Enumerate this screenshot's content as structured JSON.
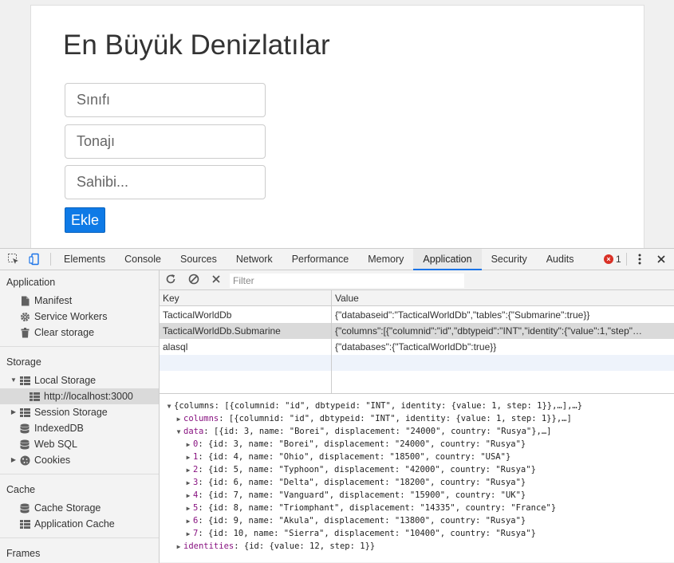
{
  "page": {
    "title": "En Büyük Denizlatılar",
    "inputs": [
      {
        "placeholder": "Sınıfı",
        "value": ""
      },
      {
        "placeholder": "Tonajı",
        "value": ""
      },
      {
        "placeholder": "Sahibi...",
        "value": ""
      }
    ],
    "add_button": "Ekle"
  },
  "devtools": {
    "tabs": [
      "Elements",
      "Console",
      "Sources",
      "Network",
      "Performance",
      "Memory",
      "Application",
      "Security",
      "Audits"
    ],
    "active_tab": "Application",
    "error_count": "1",
    "sidebar": {
      "application_heading": "Application",
      "application_items": [
        "Manifest",
        "Service Workers",
        "Clear storage"
      ],
      "storage_heading": "Storage",
      "storage_items": [
        "Local Storage",
        "http://localhost:3000",
        "Session Storage",
        "IndexedDB",
        "Web SQL",
        "Cookies"
      ],
      "cache_heading": "Cache",
      "cache_items": [
        "Cache Storage",
        "Application Cache"
      ],
      "frames_heading": "Frames"
    },
    "filter_placeholder": "Filter",
    "table": {
      "key_header": "Key",
      "value_header": "Value",
      "rows": [
        {
          "key": "TacticalWorldDb",
          "value": "{\"databaseid\":\"TacticalWorldDb\",\"tables\":{\"Submarine\":true}}"
        },
        {
          "key": "TacticalWorldDb.Submarine",
          "value": "{\"columns\":[{\"columnid\":\"id\",\"dbtypeid\":\"INT\",\"identity\":{\"value\":1,\"step\"…"
        },
        {
          "key": "alasql",
          "value": "{\"databases\":{\"TacticalWorldDb\":true}}"
        }
      ],
      "selected_row": 1
    },
    "preview": {
      "root": "{columns: [{columnid: \"id\", dbtypeid: \"INT\", identity: {value: 1, step: 1}},…],…}",
      "columns_key": "columns",
      "columns_val": "[{columnid: \"id\", dbtypeid: \"INT\", identity: {value: 1, step: 1}},…]",
      "data_key": "data",
      "data_val": "[{id: 3, name: \"Borei\", displacement: \"24000\", country: \"Rusya\"},…]",
      "data_items": [
        {
          "index": "0",
          "text": "{id: 3, name: \"Borei\", displacement: \"24000\", country: \"Rusya\"}"
        },
        {
          "index": "1",
          "text": "{id: 4, name: \"Ohio\", displacement: \"18500\", country: \"USA\"}"
        },
        {
          "index": "2",
          "text": "{id: 5, name: \"Typhoon\", displacement: \"42000\", country: \"Rusya\"}"
        },
        {
          "index": "3",
          "text": "{id: 6, name: \"Delta\", displacement: \"18200\", country: \"Rusya\"}"
        },
        {
          "index": "4",
          "text": "{id: 7, name: \"Vanguard\", displacement: \"15900\", country: \"UK\"}"
        },
        {
          "index": "5",
          "text": "{id: 8, name: \"Triomphant\", displacement: \"14335\", country: \"France\"}"
        },
        {
          "index": "6",
          "text": "{id: 9, name: \"Akula\", displacement: \"13800\", country: \"Rusya\"}"
        },
        {
          "index": "7",
          "text": "{id: 10, name: \"Sierra\", displacement: \"10400\", country: \"Rusya\"}"
        }
      ],
      "identities_key": "identities",
      "identities_val": "{id: {value: 12, step: 1}}"
    }
  },
  "colors": {
    "accent": "#1a73e8",
    "button": "#0e7ae6",
    "error": "#d93025",
    "property": "#881280"
  },
  "icons": [
    "inspect-icon",
    "device-toggle-icon",
    "error-icon",
    "kebab-menu-icon",
    "close-icon",
    "document-icon",
    "gear-icon",
    "trash-icon",
    "grid-icon",
    "database-icon",
    "cookie-icon",
    "refresh-icon",
    "clear-all-icon",
    "delete-icon"
  ]
}
